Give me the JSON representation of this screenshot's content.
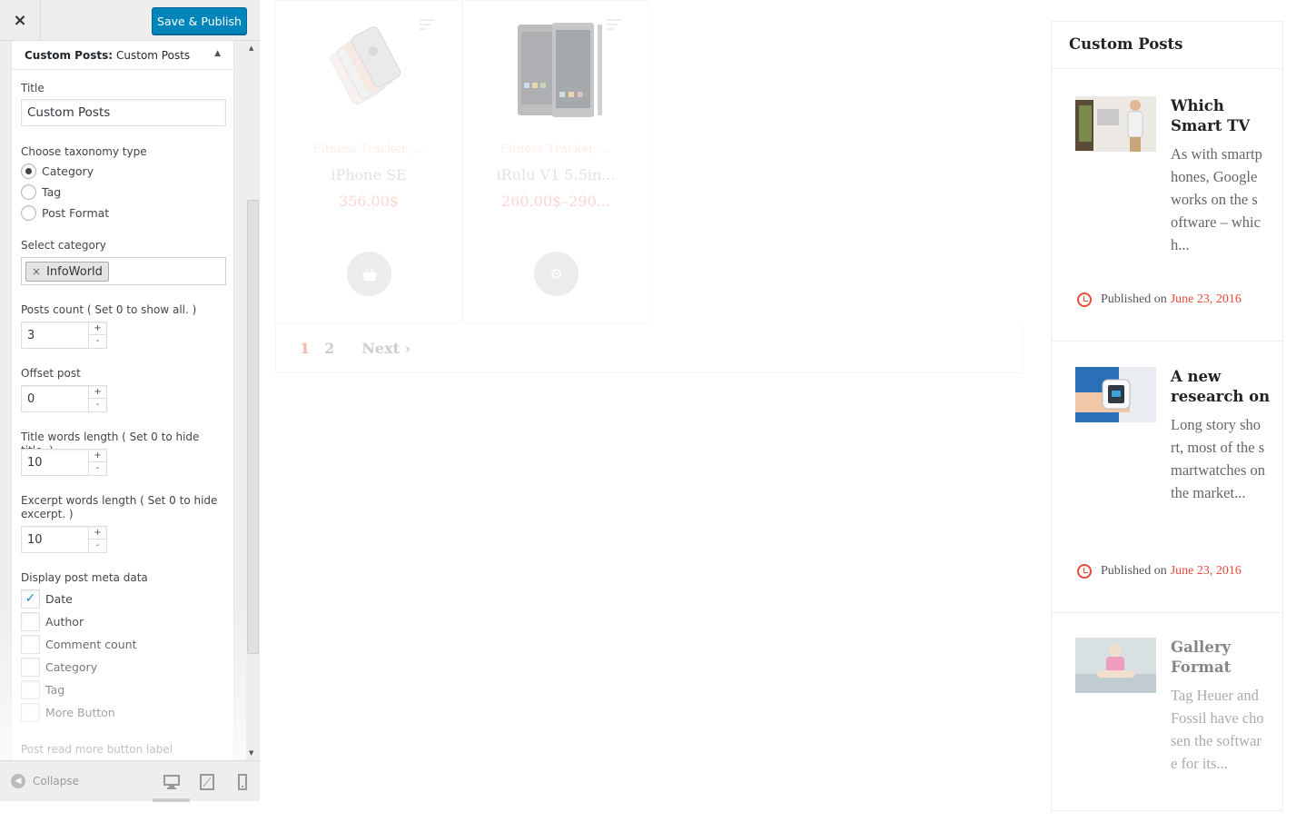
{
  "customizer": {
    "close_icon": "×",
    "save_label": "Save & Publish",
    "section_prefix": "Custom Posts:",
    "section_title": "Custom Posts",
    "fields": {
      "title_label": "Title",
      "title_value": "Custom Posts",
      "taxonomy_label": "Choose taxonomy type",
      "taxonomy_options": [
        "Category",
        "Tag",
        "Post Format"
      ],
      "taxonomy_selected": "Category",
      "select_category_label": "Select category",
      "category_chip": "InfoWorld",
      "posts_count_label": "Posts count ( Set 0 to show all. )",
      "posts_count_value": "3",
      "offset_label": "Offset post",
      "offset_value": "0",
      "title_words_label": "Title words length ( Set 0 to hide title. )",
      "title_words_value": "10",
      "excerpt_words_label": "Excerpt words length ( Set 0 to hide excerpt. )",
      "excerpt_words_value": "10",
      "meta_label": "Display post meta data",
      "meta_options": [
        {
          "label": "Date",
          "checked": true
        },
        {
          "label": "Author",
          "checked": false
        },
        {
          "label": "Comment count",
          "checked": false
        },
        {
          "label": "Category",
          "checked": false
        },
        {
          "label": "Tag",
          "checked": false
        },
        {
          "label": "More Button",
          "checked": false
        }
      ],
      "read_more_label": "Post read more button label"
    },
    "footer": {
      "collapse_label": "Collapse",
      "devices": [
        "desktop-icon",
        "tablet-icon",
        "mobile-icon"
      ]
    },
    "spin_plus": "+",
    "spin_minus": "-"
  },
  "preview": {
    "products": [
      {
        "category": "Fitness Tracker, ...",
        "name": "iPhone SE",
        "price": "356.00$",
        "button_icon": "basket-icon"
      },
      {
        "category": "Fitness Tracker, ...",
        "name": "iRulu V1 5.5in...",
        "price": "260.00$–290...",
        "button_icon": "gear-icon"
      }
    ],
    "pagination": {
      "current": "1",
      "page2": "2",
      "next": "Next ›"
    }
  },
  "custom_posts_widget": {
    "title": "Custom Posts",
    "published_on": "Published on",
    "posts": [
      {
        "title": "Which Smart TV",
        "excerpt": "As with smartphones, Google works on the software – which...",
        "date": "June 23, 2016"
      },
      {
        "title": "A new research on",
        "excerpt": "Long story short, most of the smartwatches on the market...",
        "date": "June 23, 2016"
      },
      {
        "title": "Gallery Format",
        "excerpt": "Tag Heuer and Fossil have chosen the software for its...",
        "date": ""
      }
    ]
  },
  "colors": {
    "accent": "#0085ba",
    "date_red": "#e84b3a",
    "price_pink": "#fbb6a9"
  }
}
